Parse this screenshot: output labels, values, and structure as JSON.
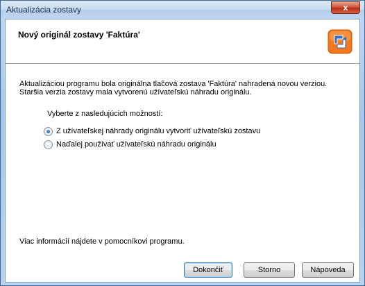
{
  "window": {
    "title": "Aktualizácia zostavy",
    "close_symbol": "x"
  },
  "header": {
    "title": "Nový originál zostavy 'Faktúra'",
    "logo_icon": "report-update-icon"
  },
  "body": {
    "line1": "Aktualizáciou programu bola originálna tlačová zostava 'Faktúra' nahradená novou verziou.",
    "line2": "Staršia verzia zostavy mala vytvorenú užívateľskú náhradu originálu."
  },
  "options": {
    "label": "Vyberte z nasledujúcich možností:",
    "items": [
      {
        "label": "Z užívateľskej náhrady originálu vytvoriť užívateľskú zostavu",
        "checked": true
      },
      {
        "label": "Naďalej používať užívateľskú náhradu originálu",
        "checked": false
      }
    ]
  },
  "footer": {
    "info": "Viac informácií nájdete v pomocníkovi programu.",
    "buttons": {
      "finish": "Dokončiť",
      "cancel": "Storno",
      "help": "Nápoveda"
    }
  },
  "colors": {
    "titlebar": "#c6dbf2",
    "close_button": "#c9442a",
    "logo_orange": "#f2781e",
    "logo_blue": "#2f6fc3"
  }
}
